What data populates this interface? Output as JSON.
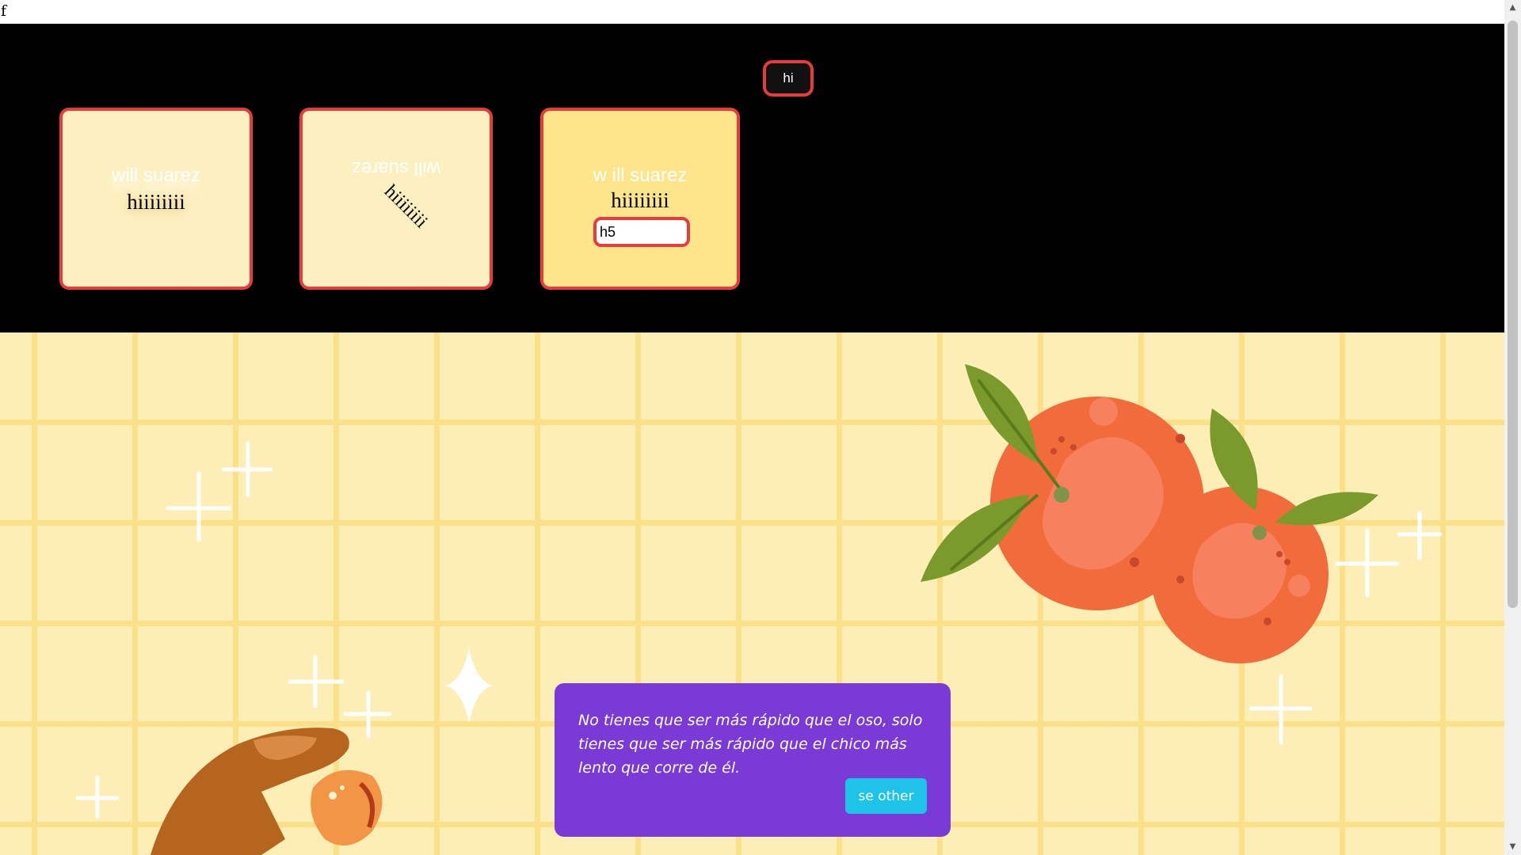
{
  "page": {
    "corner_text": "f"
  },
  "cards": [
    {
      "name": "will suarez",
      "text": "hiiiiiiii"
    },
    {
      "name": "will suarez",
      "text": "hiiiiiiii"
    },
    {
      "name": "w ill suarez",
      "text": "hiiiiiiii",
      "input_value": "h5"
    }
  ],
  "hi_button": {
    "label": "hi"
  },
  "quote": {
    "text": "No tienes que ser más rápido que el oso, solo tienes que ser más rápido que el chico más lento que corre de él.",
    "button_label": "se other",
    "background": "#7a3ad6",
    "button_color": "#1ec3e8"
  },
  "colors": {
    "accent_border": "#e63c3c",
    "card_background": "#fdf0c0",
    "card_background_active": "#fde58c",
    "illustration_background": "#fdeeb6",
    "orange": "#f26b3a",
    "leaf": "#7a9a2c"
  },
  "icons": {
    "scroll_up": "▲",
    "scroll_down": "▼"
  }
}
